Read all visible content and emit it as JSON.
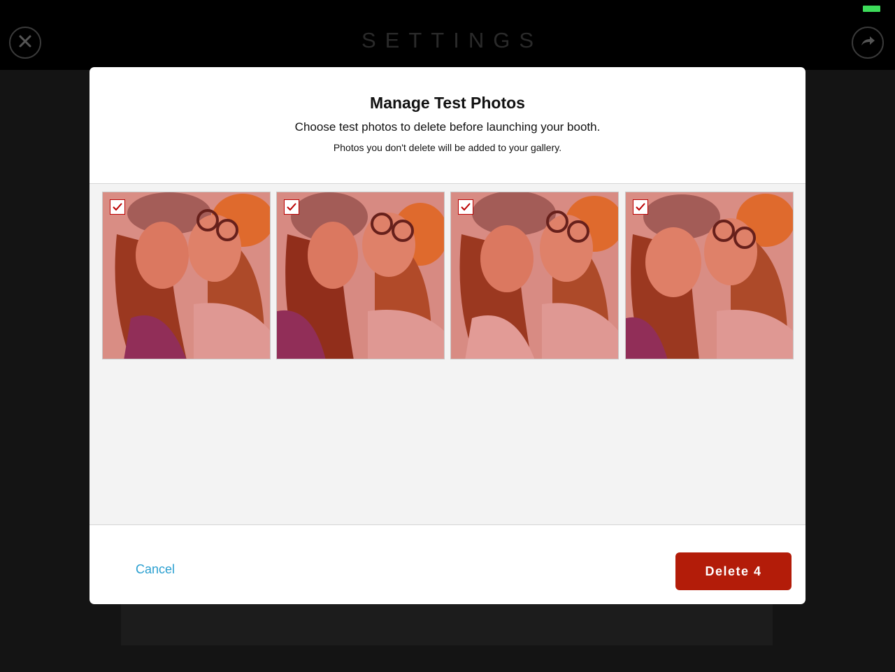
{
  "header": {
    "title": "SETTINGS",
    "close_icon": "close-icon",
    "share_icon": "share-arrow-icon",
    "battery_color": "#3ddc5a"
  },
  "modal": {
    "title": "Manage Test Photos",
    "subtitle": "Choose test photos to delete before launching your booth.",
    "note": "Photos you don't delete will be added to your gallery.",
    "photos": [
      {
        "selected": true
      },
      {
        "selected": true
      },
      {
        "selected": true
      },
      {
        "selected": true
      }
    ],
    "cancel_label": "Cancel",
    "delete_label": "Delete 4",
    "accent_color": "#b31c09",
    "link_color": "#2a9fd0"
  }
}
